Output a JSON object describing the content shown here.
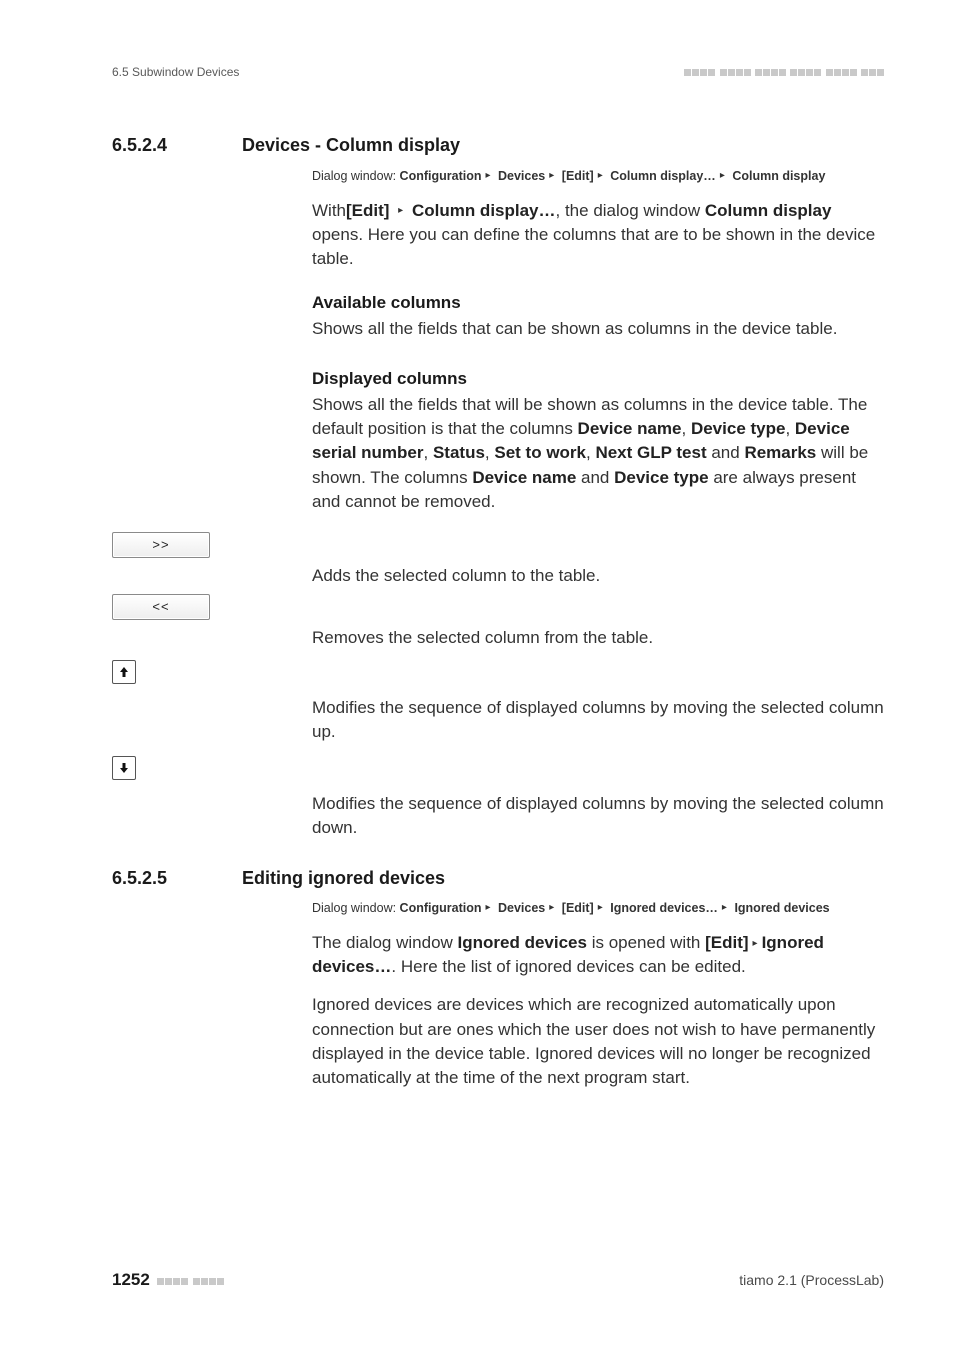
{
  "running_head": {
    "left": "6.5 Subwindow Devices"
  },
  "sections": [
    {
      "number": "6.5.2.4",
      "title": "Devices - Column display",
      "dialog": {
        "prefix": "Dialog window: ",
        "path": [
          "Configuration",
          "Devices",
          "[Edit]",
          "Column display…",
          "Column display"
        ]
      },
      "intro_parts": {
        "p1": "With",
        "b1": "[Edit]",
        "b2": "Column display…",
        "p2": ", the dialog window ",
        "b3": "Column display",
        "p3": " opens. Here you can define the columns that are to be shown in the device table."
      },
      "blocks": [
        {
          "head": "Available columns",
          "text": "Shows all the fields that can be shown as columns in the device table."
        }
      ],
      "displayed": {
        "head": "Displayed columns",
        "p1": "Shows all the fields that will be shown as columns in the device table. The default position is that the columns ",
        "b1": "Device name",
        "b2": "Device type",
        "b3": "Device serial number",
        "b4": "Status",
        "b5": "Set to work",
        "b6": "Next GLP test",
        "b7": "Remarks",
        "p2": " will be shown. The columns ",
        "b8": "Device name",
        "p3": " and ",
        "b9": "Device type",
        "p4": " are always present and cannot be removed."
      },
      "buttons": [
        {
          "label": ">>",
          "text": "Adds the selected column to the table."
        },
        {
          "label": "<<",
          "text": "Removes the selected column from the table."
        }
      ],
      "arrows": [
        {
          "type": "up",
          "text": "Modifies the sequence of displayed columns by moving the selected column up."
        },
        {
          "type": "down",
          "text": "Modifies the sequence of displayed columns by moving the selected column down."
        }
      ]
    },
    {
      "number": "6.5.2.5",
      "title": "Editing ignored devices",
      "dialog": {
        "prefix": "Dialog window: ",
        "path": [
          "Configuration",
          "Devices",
          "[Edit]",
          "Ignored devices…",
          "Ignored devices"
        ]
      },
      "intro2": {
        "p1": "The dialog window ",
        "b1": "Ignored devices",
        "p2": " is opened with ",
        "b2": "[Edit]",
        "b3": "Ignored devices…",
        "p3": ". Here the list of ignored devices can be edited."
      },
      "para2": "Ignored devices are devices which are recognized automatically upon connection but are ones which the user does not wish to have permanently displayed in the device table. Ignored devices will no longer be recognized automatically at the time of the next program start."
    }
  ],
  "footer": {
    "page": "1252",
    "product": "tiamo 2.1 (ProcessLab)"
  }
}
